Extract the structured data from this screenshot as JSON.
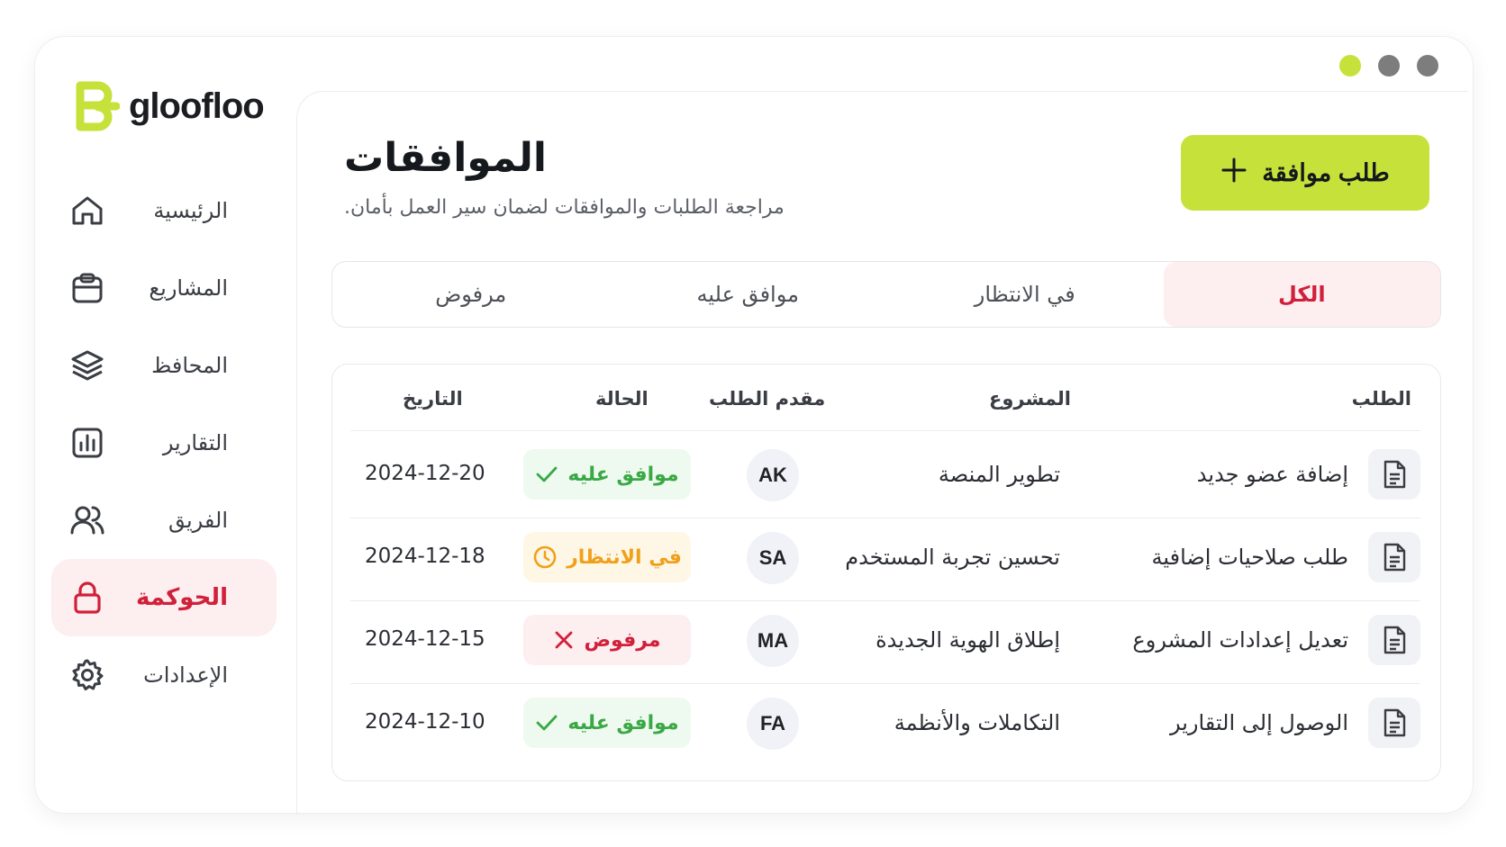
{
  "brand": {
    "name": "gloofloo",
    "accent": "#c6e23a",
    "danger": "#d1203a"
  },
  "window_dots": [
    "#c6e23a",
    "#7d7d7d",
    "#7d7d7d"
  ],
  "sidebar": {
    "items": [
      {
        "label": "الرئيسية",
        "icon": "home-icon",
        "active": false
      },
      {
        "label": "المشاريع",
        "icon": "clipboard-icon",
        "active": false
      },
      {
        "label": "المحافظ",
        "icon": "layers-icon",
        "active": false
      },
      {
        "label": "التقارير",
        "icon": "bar-chart-icon",
        "active": false
      },
      {
        "label": "الفريق",
        "icon": "users-icon",
        "active": false
      },
      {
        "label": "الحوكمة",
        "icon": "lock-icon",
        "active": true
      },
      {
        "label": "الإعدادات",
        "icon": "gear-icon",
        "active": false
      }
    ]
  },
  "header": {
    "title": "الموافقات",
    "subtitle": "مراجعة الطلبات والموافقات لضمان سير العمل بأمان.",
    "add_button_label": "طلب موافقة",
    "add_button_icon": "plus-icon"
  },
  "tabs": [
    {
      "label": "الكل",
      "active": true
    },
    {
      "label": "في الانتظار",
      "active": false
    },
    {
      "label": "موافق عليه",
      "active": false
    },
    {
      "label": "مرفوض",
      "active": false
    }
  ],
  "table": {
    "columns": {
      "request": "الطلب",
      "project": "المشروع",
      "requester": "مقدم الطلب",
      "status": "الحالة",
      "date": "التاريخ"
    },
    "rows": [
      {
        "request": "إضافة عضو جديد",
        "project": "تطوير المنصة",
        "requester": "AK",
        "status": "موافق عليه",
        "status_type": "approved",
        "date": "2024-12-20"
      },
      {
        "request": "طلب صلاحيات إضافية",
        "project": "تحسين تجربة المستخدم",
        "requester": "SA",
        "status": "في الانتظار",
        "status_type": "pending",
        "date": "2024-12-18"
      },
      {
        "request": "تعديل إعدادات المشروع",
        "project": "إطلاق الهوية الجديدة",
        "requester": "MA",
        "status": "مرفوض",
        "status_type": "rejected",
        "date": "2024-12-15"
      },
      {
        "request": "الوصول إلى التقارير",
        "project": "التكاملات والأنظمة",
        "requester": "FA",
        "status": "موافق عليه",
        "status_type": "approved",
        "date": "2024-12-10"
      }
    ]
  }
}
